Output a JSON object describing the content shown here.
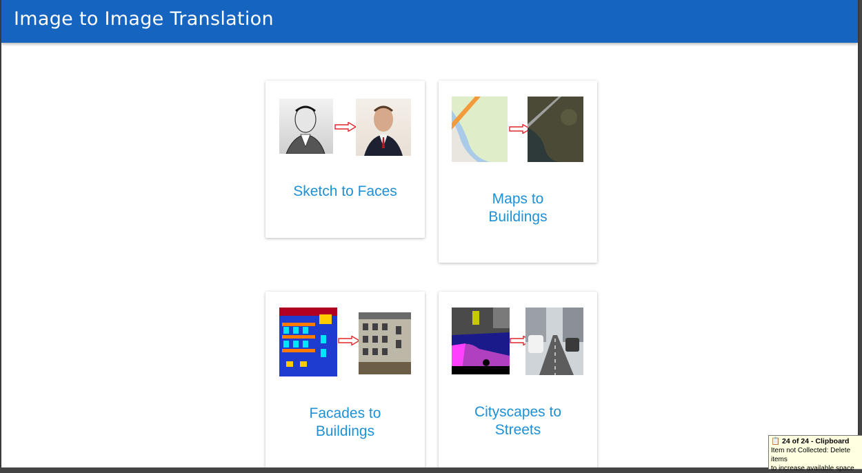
{
  "header": {
    "title": "Image to Image Translation"
  },
  "cards": [
    {
      "label": "Sketch to Faces"
    },
    {
      "label": "Maps to\nBuildings"
    },
    {
      "label": "Facades to\nBuildings"
    },
    {
      "label": "Cityscapes to\nStreets"
    }
  ],
  "clipboard": {
    "title": "24 of 24 - Clipboard",
    "line1": "Item not Collected: Delete items",
    "line2": "to increase available space"
  },
  "colors": {
    "header": "#1565c0",
    "label": "#1e90d6",
    "arrow": "#e0262b"
  }
}
